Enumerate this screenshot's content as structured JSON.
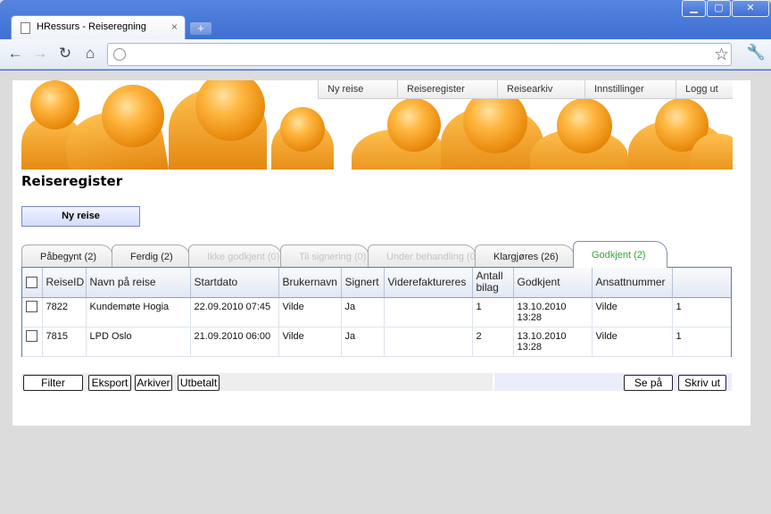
{
  "browser": {
    "tab_title": "HRessurs - Reiseregning",
    "close_glyph": "×",
    "newtab_glyph": "+",
    "window_controls": {
      "minimize": "▁",
      "maximize": "▢",
      "close": "✕"
    },
    "nav": {
      "back": "←",
      "forward": "→",
      "reload": "↻",
      "home": "⌂",
      "star": "☆",
      "wrench": "🔧"
    }
  },
  "topnav": {
    "items": [
      {
        "label": "Ny reise"
      },
      {
        "label": "Reiseregister"
      },
      {
        "label": "Reisearkiv"
      },
      {
        "label": "Innstillinger"
      },
      {
        "label": "Logg ut"
      }
    ]
  },
  "page": {
    "title": "Reiseregister",
    "new_button": "Ny reise"
  },
  "tabs": [
    {
      "label": "Påbegynt (2)",
      "state": "normal"
    },
    {
      "label": "Ferdig (2)",
      "state": "normal"
    },
    {
      "label": "Ikke godkjent (0)",
      "state": "disabled"
    },
    {
      "label": "Til signering (0)",
      "state": "disabled"
    },
    {
      "label": "Under behandling (0)",
      "state": "disabled"
    },
    {
      "label": "Klargjøres (26)",
      "state": "normal"
    },
    {
      "label": "Godkjent (2)",
      "state": "active"
    }
  ],
  "table": {
    "headers": [
      "ReiseID",
      "Navn på reise",
      "Startdato",
      "Brukernavn",
      "Signert",
      "Viderefaktureres",
      "Antall bilag",
      "Godkjent",
      "Ansattnummer",
      ""
    ],
    "rows": [
      [
        "7822",
        "Kundemøte Hogia",
        "22.09.2010 07:45",
        "Vilde",
        "Ja",
        "",
        "1",
        "13.10.2010 13:28",
        "Vilde",
        "1"
      ],
      [
        "7815",
        "LPD Oslo",
        "21.09.2010 06:00",
        "Vilde",
        "Ja",
        "",
        "2",
        "13.10.2010 13:28",
        "Vilde",
        "1"
      ]
    ]
  },
  "bottombar": {
    "filter": "Filter",
    "export": "Eksport",
    "archive": "Arkiver",
    "paid": "Utbetalt",
    "view": "Se på",
    "print": "Skriv ut"
  },
  "colors": {
    "active_tab_text": "#3aa13a",
    "window_blue": "#3c6ed0",
    "banner_orange": "#e88a0c"
  }
}
